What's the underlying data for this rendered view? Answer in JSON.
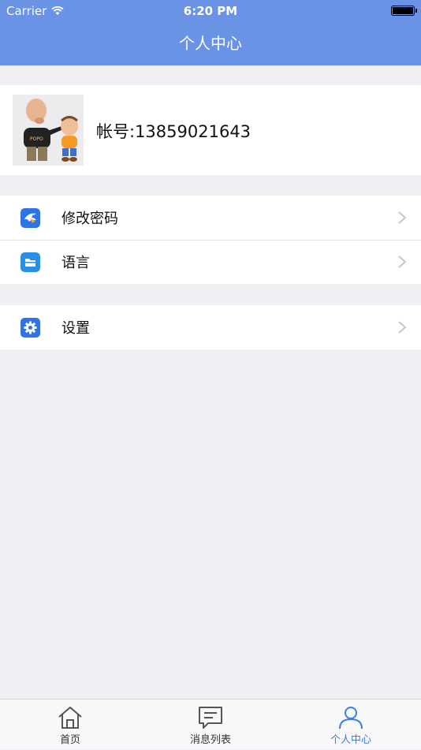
{
  "status_bar": {
    "carrier": "Carrier",
    "time": "6:20 PM"
  },
  "nav": {
    "title": "个人中心"
  },
  "profile": {
    "account": "帐号:13859021643"
  },
  "menu": [
    {
      "label": "修改密码",
      "icon": "bird-icon",
      "color": "#2e74e6"
    },
    {
      "label": "语言",
      "icon": "folder-icon",
      "color": "#2a8ee8"
    }
  ],
  "settings": {
    "label": "设置",
    "icon": "gear-icon",
    "color": "#2e74e6"
  },
  "tabs": [
    {
      "label": "首页",
      "icon": "home-icon"
    },
    {
      "label": "消息列表",
      "icon": "message-icon"
    },
    {
      "label": "个人中心",
      "icon": "person-icon",
      "active": true
    }
  ],
  "colors": {
    "primary": "#6a93e5",
    "active_tab": "#3b7ee0",
    "background": "#efeff4"
  }
}
